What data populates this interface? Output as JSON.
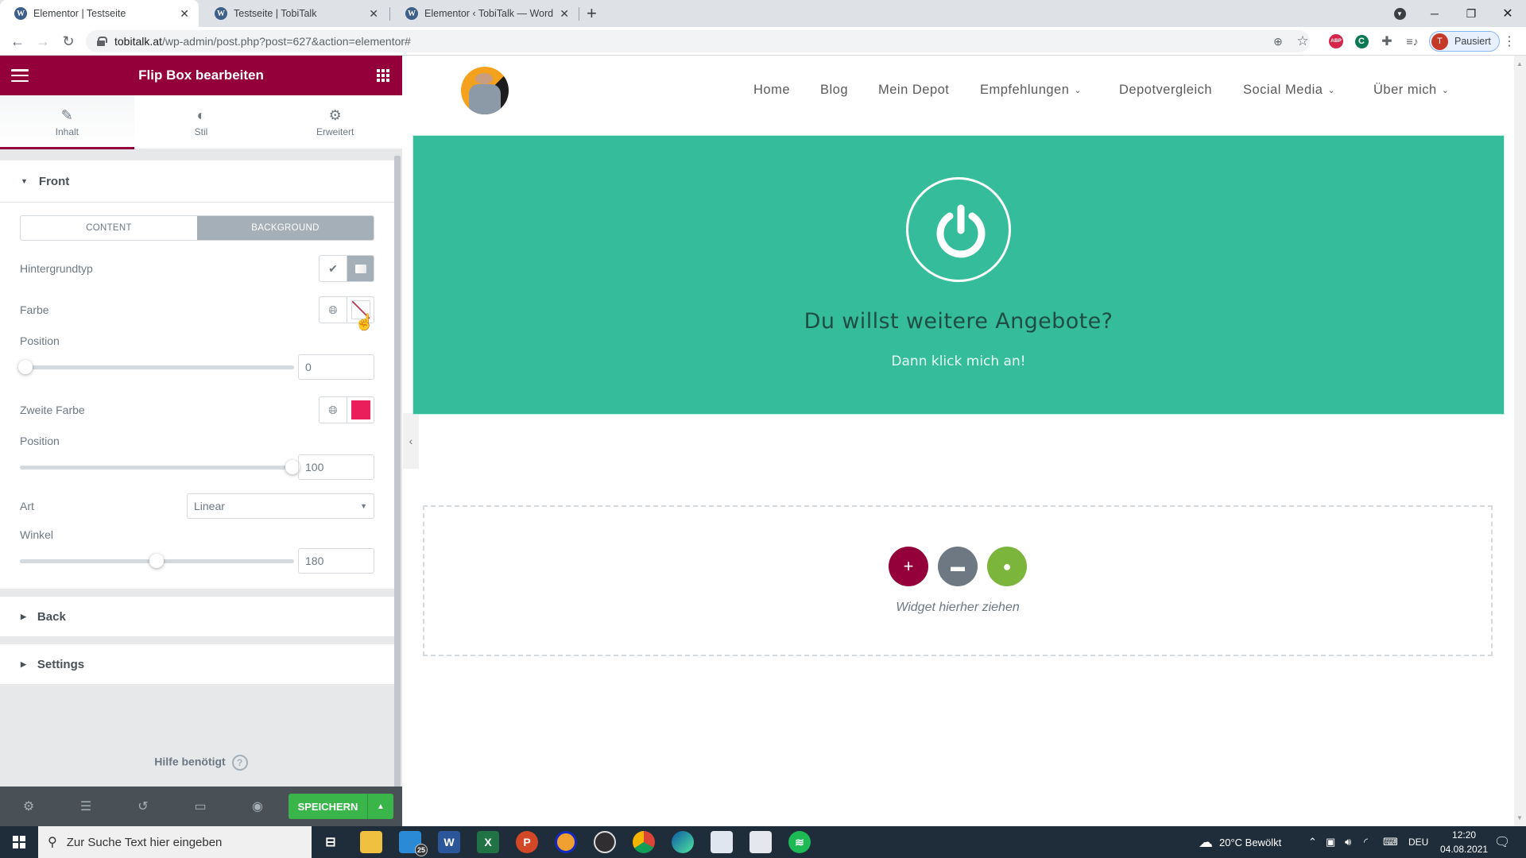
{
  "browser": {
    "tabs": [
      {
        "title": "Elementor | Testseite",
        "active": true
      },
      {
        "title": "Testseite | TobiTalk",
        "active": false
      },
      {
        "title": "Elementor ‹ TobiTalk — WordPre",
        "active": false
      }
    ],
    "url_domain": "tobitalk.at",
    "url_path": "/wp-admin/post.php?post=627&action=elementor#",
    "profile_initial": "T",
    "profile_status": "Pausiert",
    "extension_abp": "ABP"
  },
  "panel": {
    "title": "Flip Box bearbeiten",
    "tabs": [
      {
        "label": "Inhalt",
        "icon": "pencil-icon",
        "active": true
      },
      {
        "label": "Stil",
        "icon": "half-circle-icon",
        "active": false
      },
      {
        "label": "Erweitert",
        "icon": "gear-icon",
        "active": false
      }
    ],
    "sections": {
      "front": {
        "label": "Front",
        "expanded": true,
        "switcher": {
          "content": "CONTENT",
          "background": "BACKGROUND",
          "active": "BACKGROUND"
        },
        "background_type_label": "Hintergrundtyp",
        "color_label": "Farbe",
        "color_value": "none",
        "position1_label": "Position",
        "position1_value": "0",
        "second_color_label": "Zweite Farbe",
        "second_color_value": "#e91e5a",
        "position2_label": "Position",
        "position2_value": "100",
        "type_label": "Art",
        "type_value": "Linear",
        "angle_label": "Winkel",
        "angle_value": "180"
      },
      "back": {
        "label": "Back",
        "expanded": false
      },
      "settings": {
        "label": "Settings",
        "expanded": false
      }
    },
    "help_label": "Hilfe benötigt",
    "save_label": "SPEICHERN"
  },
  "site": {
    "nav": [
      {
        "label": "Home",
        "dropdown": false
      },
      {
        "label": "Blog",
        "dropdown": false
      },
      {
        "label": "Mein Depot",
        "dropdown": false
      },
      {
        "label": "Empfehlungen",
        "dropdown": true
      },
      {
        "label": "Depotvergleich",
        "dropdown": false
      },
      {
        "label": "Social Media",
        "dropdown": true
      },
      {
        "label": "Über mich",
        "dropdown": true
      }
    ],
    "flipbox": {
      "title": "Du willst weitere Angebote?",
      "subtitle": "Dann klick mich an!",
      "background": "#35bd9b"
    },
    "dropzone_label": "Widget hierher ziehen"
  },
  "taskbar": {
    "search_placeholder": "Zur Suche Text hier eingeben",
    "mail_badge": "25",
    "weather": "20°C  Bewölkt",
    "language": "DEU",
    "time": "12:20",
    "date": "04.08.2021"
  },
  "colors": {
    "elementor_brand": "#93003a",
    "save_green": "#39b54a",
    "flipbox_teal": "#35bd9b"
  }
}
